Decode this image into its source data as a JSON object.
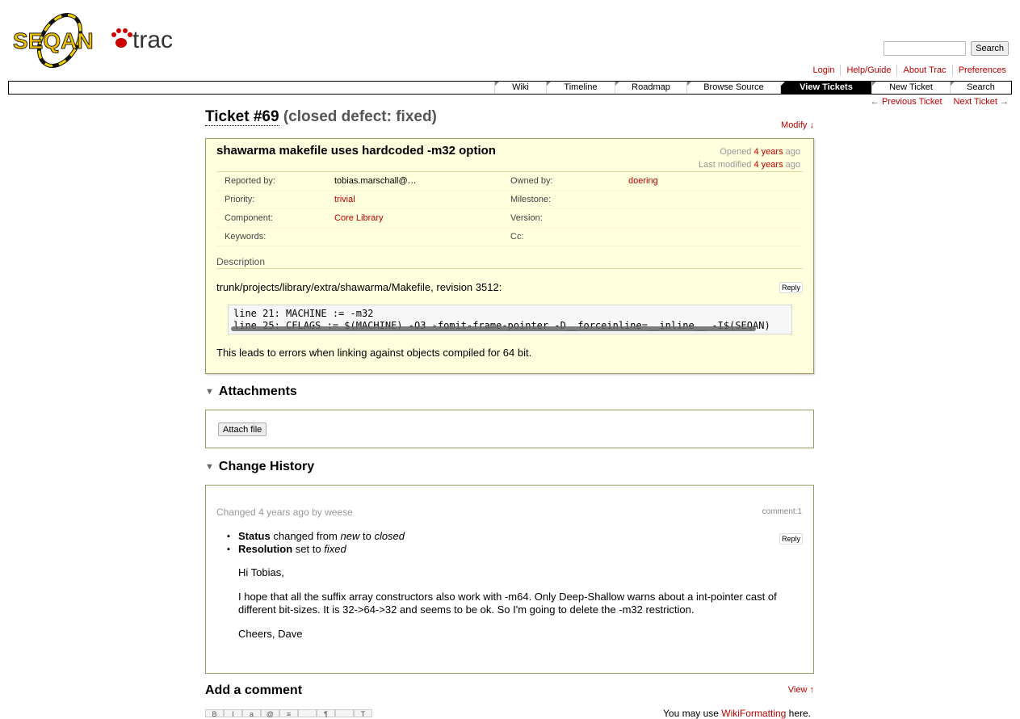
{
  "header": {
    "logo_left": "SEQAN",
    "logo_right": "trac",
    "search_button": "Search"
  },
  "metanav": [
    "Login",
    "Help/Guide",
    "About Trac",
    "Preferences"
  ],
  "mainnav": [
    {
      "label": "Wiki",
      "active": false
    },
    {
      "label": "Timeline",
      "active": false
    },
    {
      "label": "Roadmap",
      "active": false
    },
    {
      "label": "Browse Source",
      "active": false
    },
    {
      "label": "View Tickets",
      "active": true
    },
    {
      "label": "New Ticket",
      "active": false
    },
    {
      "label": "Search",
      "active": false
    }
  ],
  "ctxtnav": {
    "prev": "Previous Ticket",
    "next": "Next Ticket"
  },
  "ticket": {
    "number": "Ticket #69",
    "status": "(closed defect: fixed)",
    "modify": "Modify ↓",
    "summary": "shawarma makefile uses hardcoded -m32 option",
    "opened_prefix": "Opened",
    "opened_age": "4 years",
    "opened_suffix": "ago",
    "modified_prefix": "Last modified",
    "modified_age": "4 years",
    "modified_suffix": "ago",
    "props": [
      {
        "l1": "Reported by:",
        "v1": "tobias.marschall@…",
        "v1_link": false,
        "l2": "Owned by:",
        "v2": "doering",
        "v2_link": true
      },
      {
        "l1": "Priority:",
        "v1": "trivial",
        "v1_link": true,
        "l2": "Milestone:",
        "v2": "",
        "v2_link": false
      },
      {
        "l1": "Component:",
        "v1": "Core Library",
        "v1_link": true,
        "l2": "Version:",
        "v2": "",
        "v2_link": false
      },
      {
        "l1": "Keywords:",
        "v1": "",
        "v1_link": false,
        "l2": "Cc:",
        "v2": "",
        "v2_link": false
      }
    ],
    "description_heading": "Description",
    "desc_line1": "trunk/projects/library/extra/shawarma/Makefile, revision 3512:",
    "reply": "Reply",
    "code_line1": "line 21: MACHINE := -m32",
    "code_line2": "line 25: CFLAGS := $(MACHINE) -O3 -fomit-frame-pointer -D__forceinline=__inline__ -I$(SEQAN)",
    "desc_line2": "This leads to errors when linking against objects compiled for 64 bit."
  },
  "attachments": {
    "heading": "Attachments",
    "button": "Attach file"
  },
  "history": {
    "heading": "Change History",
    "changed_prefix": "Changed",
    "changed_age": "4 years ago",
    "changed_by": "by weese",
    "comment_ref": "comment:1",
    "reply": "Reply",
    "changes": [
      {
        "field": "Status",
        "verb": "changed from",
        "from": "new",
        "to_word": "to",
        "to": "closed"
      },
      {
        "field": "Resolution",
        "verb": "set to",
        "value": "fixed"
      }
    ],
    "greeting": "Hi Tobias,",
    "body": "I hope that all the suffix array constructors also work with -m64. Only Deep-Shallow warns about a int-pointer cast of different bit-sizes. It is 32->64->32 and seems to be ok. So I'm going to delete the -m32 restriction.",
    "signoff": "Cheers, Dave"
  },
  "add_comment": {
    "heading": "Add a comment",
    "view": "View ↑",
    "note_prefix": "You may use",
    "note_link": "WikiFormatting",
    "note_suffix": "here."
  },
  "toolbar": [
    "B",
    "I",
    "a",
    "@",
    "≡",
    "",
    "¶",
    "",
    "T"
  ]
}
